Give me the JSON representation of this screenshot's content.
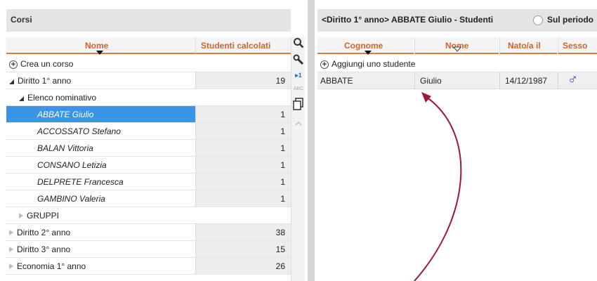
{
  "left": {
    "title": "Corsi",
    "columns": {
      "name": "Nome",
      "count": "Studenti calcolati"
    },
    "create_label": "Crea un corso",
    "rows": [
      {
        "label": "Diritto 1° anno",
        "count": "19"
      },
      {
        "label": "Elenco nominativo"
      },
      {
        "label": "ABBATE Giulio",
        "count": "1"
      },
      {
        "label": "ACCOSSATO Stefano",
        "count": "1"
      },
      {
        "label": "BALAN Vittoria",
        "count": "1"
      },
      {
        "label": "CONSANO Letizia",
        "count": "1"
      },
      {
        "label": "DELPRETE Francesca",
        "count": "1"
      },
      {
        "label": "GAMBINO Valeria",
        "count": "1"
      },
      {
        "label": "GRUPPI"
      },
      {
        "label": "Diritto 2° anno",
        "count": "38"
      },
      {
        "label": "Diritto 3° anno",
        "count": "15"
      },
      {
        "label": "Economia 1° anno",
        "count": "26"
      }
    ],
    "tools": {
      "arrow_one": "▸1",
      "abc": "ABC"
    }
  },
  "right": {
    "title": "<Diritto 1° anno> ABBATE Giulio - Studenti",
    "period_label": "Sul periodo",
    "columns": {
      "surname": "Cognome",
      "name": "Nome",
      "born": "Nato/a il",
      "sex": "Sesso"
    },
    "add_label": "Aggiungi uno studente",
    "students": [
      {
        "surname": "ABBATE",
        "name": "Giulio",
        "born": "14/12/1987",
        "sex": "♂"
      }
    ]
  },
  "colors": {
    "accent": "#e07a3a",
    "selection": "#3a95e6",
    "annotation": "#a01838"
  }
}
